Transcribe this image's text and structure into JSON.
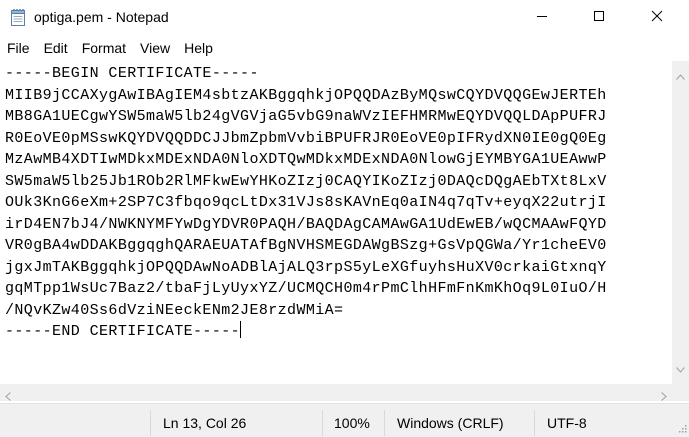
{
  "window": {
    "title": "optiga.pem - Notepad",
    "controls": {
      "minimize": "minimize-icon",
      "maximize": "maximize-icon",
      "close": "close-icon"
    }
  },
  "menu": {
    "items": [
      "File",
      "Edit",
      "Format",
      "View",
      "Help"
    ]
  },
  "editor": {
    "lines": [
      "-----BEGIN CERTIFICATE-----",
      "MIIB9jCCAXygAwIBAgIEM4sbtzAKBggqhkjOPQQDAzByMQswCQYDVQQGEwJERTEh",
      "MB8GA1UECgwYSW5maW5lb24gVGVjaG5vbG9naWVzIEFHMRMwEQYDVQQLDApPUFRJ",
      "R0EoVE0pMSswKQYDVQQDDCJJbmZpbmVvbiBPUFRJR0EoVE0pIFRydXN0IE0gQ0Eg",
      "MzAwMB4XDTIwMDkxMDExNDA0NloXDTQwMDkxMDExNDA0NlowGjEYMBYGA1UEAwwP",
      "SW5maW5lb25Jb1ROb2RlMFkwEwYHKoZIzj0CAQYIKoZIzj0DAQcDQgAEbTXt8LxV",
      "OUk3KnG6eXm+2SP7C3fbqo9qcLtDx31VJs8sKAVnEq0aIN4q7qTv+eyqX22utrjI",
      "irD4EN7bJ4/NWKNYMFYwDgYDVR0PAQH/BAQDAgCAMAwGA1UdEwEB/wQCMAAwFQYD",
      "VR0gBA4wDDAKBggqghQARAEUATAfBgNVHSMEGDAWgBSzg+GsVpQGWa/Yr1cheEV0",
      "jgxJmTAKBggqhkjOPQQDAwNoADBlAjALQ3rpS5yLeXGfuyhsHuXV0crkaiGtxnqY",
      "gqMTpp1WsUc7Baz2/tbaFjLyUyxYZ/UCMQCH0m4rPmClhHFmFnKmKhOq9L0IuO/H",
      "/NQvKZw40Ss6dVziNEeckENm2JE8rzdWMiA=",
      "-----END CERTIFICATE-----"
    ]
  },
  "status": {
    "position": "Ln 13, Col 26",
    "zoom": "100%",
    "line_ending": "Windows (CRLF)",
    "encoding": "UTF-8"
  }
}
